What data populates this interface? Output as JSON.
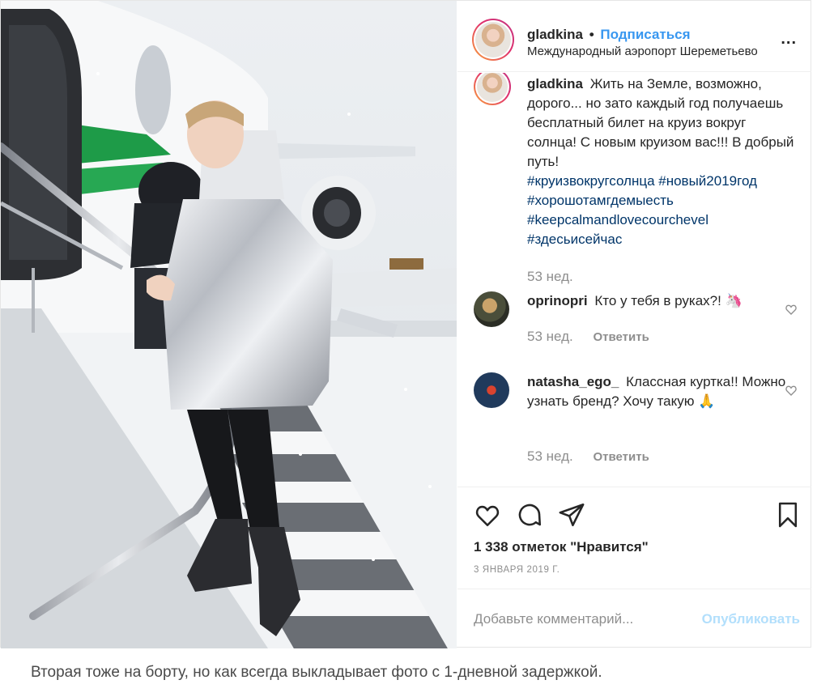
{
  "header": {
    "username": "gladkina",
    "separator": "•",
    "follow_label": "Подписаться",
    "location": "Международный аэропорт Шереметьево",
    "more_label": "..."
  },
  "caption": {
    "username": "gladkina",
    "text": "Жить на Земле, возможно, дорого... но зато каждый год получаешь бесплатный билет на круиз вокруг солнца! С новым круизом вас!!! В добрый путь!",
    "hashtag_1": "#круизвокругсолнца #новый2019год",
    "hashtag_2": "#хорошотамгдемыесть",
    "hashtag_3": "#keepcalmandlovecourchevel",
    "hashtag_4": "#здесьисейчас",
    "time": "53 нед."
  },
  "comments": [
    {
      "username": "oprinopri",
      "text": "Кто у тебя в руках?! 🦄",
      "time": "53 нед.",
      "reply_label": "Ответить"
    },
    {
      "username": "natasha_ego_",
      "text": "Классная куртка!! Можно узнать бренд? Хочу такую 🙏",
      "time": "53 нед.",
      "reply_label": "Ответить"
    }
  ],
  "actions": {
    "likes": "1 338 отметок \"Нравится\"",
    "date": "3 ЯНВАРЯ 2019 Г."
  },
  "add_comment": {
    "placeholder": "Добавьте комментарий...",
    "publish_label": "Опубликовать"
  },
  "page_caption": "Вторая тоже на борту, но как всегда выкладывает фото с 1-дневной задержкой.",
  "colors": {
    "link": "#003569",
    "follow": "#3897f0",
    "publish_disabled": "#b2dffc",
    "muted": "#8e8e8e",
    "stripe_green": "#1e9b48"
  },
  "icons": [
    "heart-icon",
    "comment-icon",
    "share-icon",
    "bookmark-icon",
    "more-icon",
    "heart-small-icon"
  ]
}
